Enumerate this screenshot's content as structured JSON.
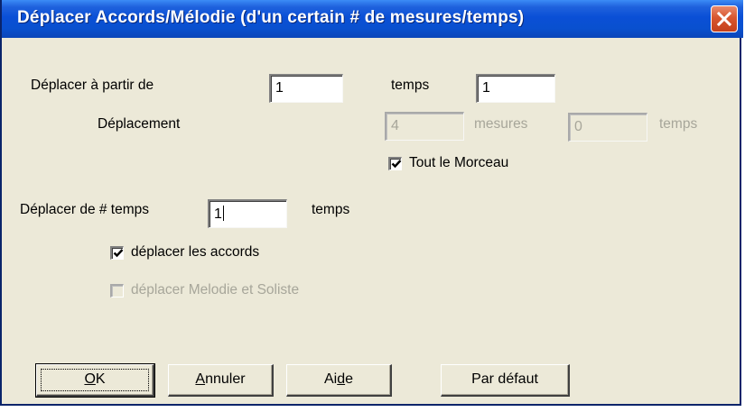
{
  "window": {
    "title": "Déplacer Accords/Mélodie (d'un certain # de mesures/temps)"
  },
  "from": {
    "label": "Déplacer à partir de",
    "bar_value": "1",
    "beat_label": "temps",
    "beat_value": "1"
  },
  "displacement": {
    "label": "Déplacement",
    "bars_value": "4",
    "bars_label": "mesures",
    "beats_value": "0",
    "beats_label": "temps",
    "whole_song_label": "Tout le Morceau",
    "whole_song_checked": true
  },
  "shift": {
    "label": "Déplacer de # temps",
    "value": "1",
    "unit_label": "temps"
  },
  "options": {
    "move_chords_label": "déplacer les accords",
    "move_chords_checked": true,
    "move_melody_label": "déplacer Melodie et Soliste",
    "move_melody_checked": false
  },
  "buttons": {
    "ok_prefix": "O",
    "ok_rest": "K",
    "cancel_prefix": "A",
    "cancel_rest": "nnuler",
    "help_before": "Ai",
    "help_mnemonic": "d",
    "help_after": "e",
    "default_label": "Par défaut"
  }
}
